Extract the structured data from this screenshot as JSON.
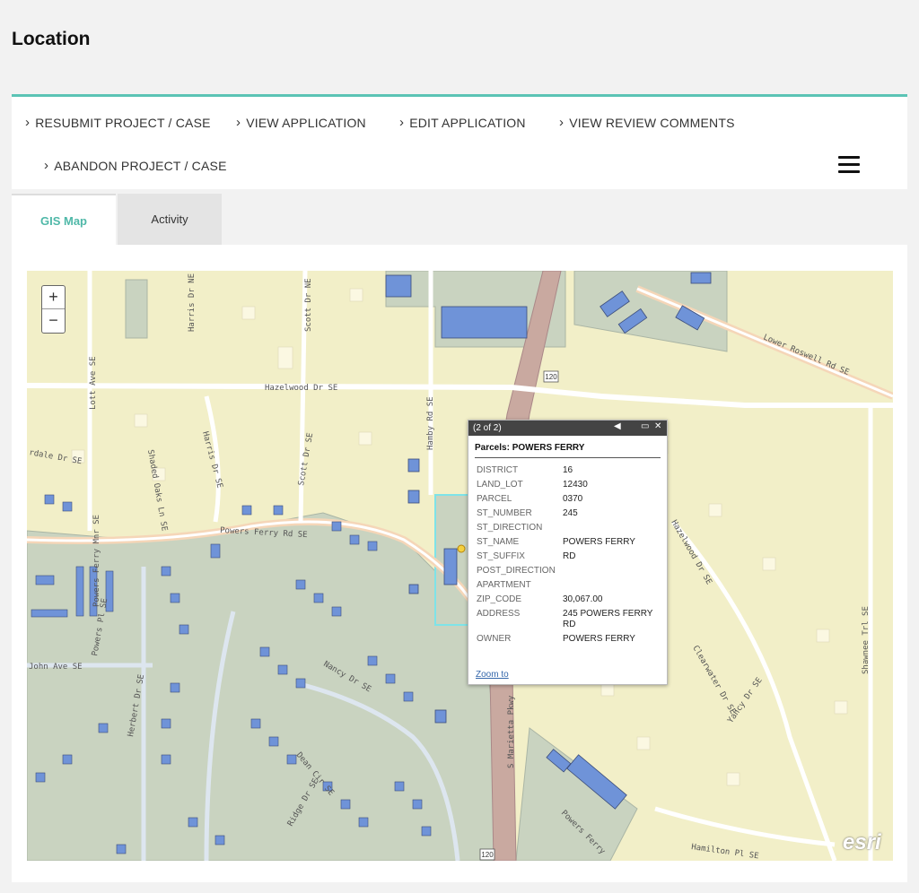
{
  "page": {
    "title": "Location"
  },
  "actions": {
    "resubmit": "RESUBMIT PROJECT / CASE",
    "view_application": "VIEW APPLICATION",
    "edit_application": "EDIT APPLICATION",
    "view_review_comments": "VIEW REVIEW COMMENTS",
    "abandon": "ABANDON PROJECT / CASE",
    "chevron": "›",
    "menu_icon": "hamburger-icon"
  },
  "tabs": [
    {
      "label": "GIS Map",
      "active": true
    },
    {
      "label": "Activity",
      "active": false
    }
  ],
  "map": {
    "zoom_in": "+",
    "zoom_out": "−",
    "labels": {
      "hazelwood": "Hazelwood Dr SE",
      "powers_ferry": "Powers Ferry Rd SE",
      "lower_roswell": "Lower Roswell Rd SE",
      "harris_ne": "Harris Dr NE",
      "scott_ne": "Scott Dr NE",
      "lott": "Lott Ave SE",
      "harris_se": "Harris Dr SE",
      "scott_se": "Scott Dr SE",
      "hamby": "Hamby Rd SE",
      "shaded_oaks": "Shaded Oaks Ln SE",
      "nancy": "Nancy Dr SE",
      "john": "John Ave SE",
      "herbert": "Herbert Dr SE",
      "powers_ferry_mnr": "Powers Ferry Mnr SE",
      "powers_pl": "Powers Pl SE",
      "marietta": "S Marietta Pkwy",
      "hazelwood_se": "Hazelwood Dr SE",
      "clearwater": "Clearwater Dr SE",
      "yancy": "Yancy Dr SE",
      "shawnee": "Shawnee Trl SE",
      "hamilton": "Hamilton Pl SE",
      "dean": "Dean Cir SE",
      "ridge": "Ridge Dr SE",
      "dale": "rdale Dr SE",
      "shield1": "120",
      "shield2": "120",
      "powers_ferry_low": "Powers Ferry"
    },
    "attribution": "esri",
    "popup": {
      "counter": "(2 of 2)",
      "title": "Parcels: POWERS FERRY",
      "zoom_link": "Zoom to",
      "rows": [
        {
          "key": "DISTRICT",
          "value": "16"
        },
        {
          "key": "LAND_LOT",
          "value": "12430"
        },
        {
          "key": "PARCEL",
          "value": "0370"
        },
        {
          "key": "ST_NUMBER",
          "value": "245"
        },
        {
          "key": "ST_DIRECTION",
          "value": ""
        },
        {
          "key": "ST_NAME",
          "value": "POWERS FERRY"
        },
        {
          "key": "ST_SUFFIX",
          "value": "RD"
        },
        {
          "key": "POST_DIRECTION",
          "value": ""
        },
        {
          "key": "APARTMENT",
          "value": ""
        },
        {
          "key": "ZIP_CODE",
          "value": "30,067.00"
        },
        {
          "key": "ADDRESS",
          "value": "245 POWERS FERRY RD"
        },
        {
          "key": "OWNER",
          "value": "POWERS FERRY"
        }
      ]
    },
    "colors": {
      "land": "#f2efc8",
      "parcel_fill": "#c9d3c0",
      "building": "#6f93d8",
      "road": "#ffffff",
      "highway": "#c9a9a0",
      "selected_parcel": "#7ee3e8"
    }
  }
}
